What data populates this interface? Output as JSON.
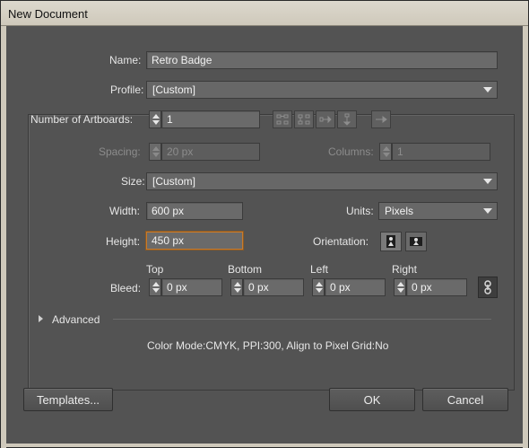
{
  "window": {
    "title": "New Document"
  },
  "name": {
    "label": "Name:",
    "value": "Retro Badge"
  },
  "profile": {
    "label": "Profile:",
    "value": "[Custom]"
  },
  "artboards": {
    "label": "Number of Artboards:",
    "value": "1"
  },
  "spacing": {
    "label": "Spacing:",
    "value": "20 px"
  },
  "columns": {
    "label": "Columns:",
    "value": "1"
  },
  "size": {
    "label": "Size:",
    "value": "[Custom]"
  },
  "width": {
    "label": "Width:",
    "value": "600 px"
  },
  "units": {
    "label": "Units:",
    "value": "Pixels"
  },
  "height": {
    "label": "Height:",
    "value": "450 px"
  },
  "orientation": {
    "label": "Orientation:"
  },
  "bleed": {
    "label": "Bleed:",
    "top": {
      "label": "Top",
      "value": "0 px"
    },
    "bottom": {
      "label": "Bottom",
      "value": "0 px"
    },
    "left": {
      "label": "Left",
      "value": "0 px"
    },
    "right": {
      "label": "Right",
      "value": "0 px"
    }
  },
  "advanced": {
    "label": "Advanced"
  },
  "summary": "Color Mode:CMYK, PPI:300, Align to Pixel Grid:No",
  "buttons": {
    "templates": "Templates...",
    "ok": "OK",
    "cancel": "Cancel"
  },
  "icons": {
    "arrange_grid_by_row": "grid-by-row-icon",
    "arrange_grid_by_column": "grid-by-column-icon",
    "arrange_by_row": "arrange-by-row-icon",
    "arrange_by_column": "arrange-by-column-icon",
    "change_to_rtl": "right-arrow-icon",
    "portrait": "portrait-icon",
    "landscape": "landscape-icon",
    "link_bleed": "chain-link-icon"
  }
}
